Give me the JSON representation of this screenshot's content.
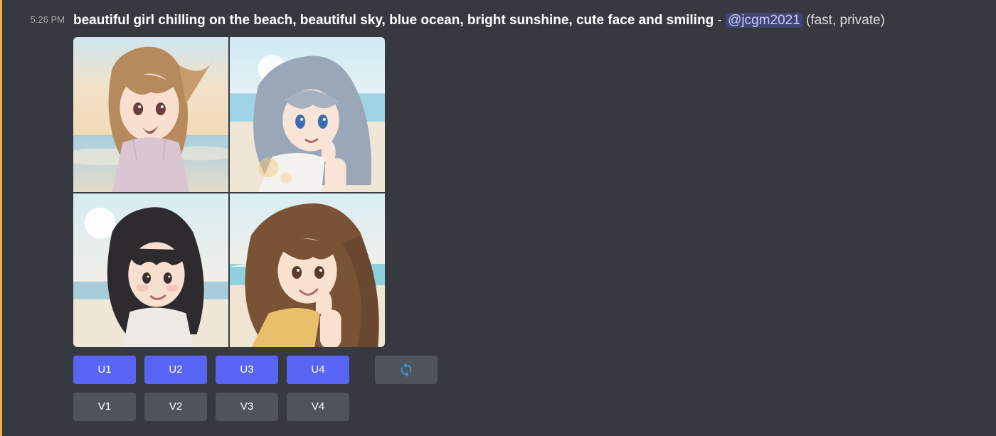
{
  "message": {
    "timestamp": "5:26 PM",
    "prompt": "beautiful girl chilling on the beach, beautiful sky, blue ocean, bright sunshine, cute face and smiling",
    "separator": " - ",
    "mention": "@jcgm2021",
    "mode": " (fast, private)"
  },
  "buttons": {
    "upscale": [
      "U1",
      "U2",
      "U3",
      "U4"
    ],
    "variation": [
      "V1",
      "V2",
      "V3",
      "V4"
    ],
    "reroll_icon": "reroll-icon"
  }
}
